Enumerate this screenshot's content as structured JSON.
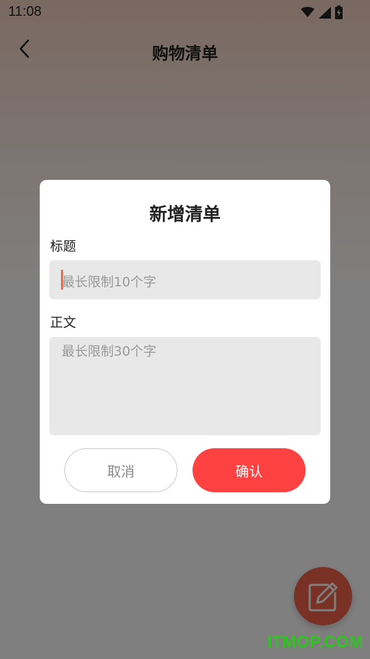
{
  "status_bar": {
    "time": "11:08",
    "icons": [
      "wifi-icon",
      "signal-icon",
      "battery-charging-icon"
    ]
  },
  "header": {
    "title": "购物清单",
    "back_icon": "chevron-left-icon"
  },
  "fab": {
    "icon": "edit-icon"
  },
  "watermark": "ITMOP.COM",
  "dialog": {
    "title": "新增清单",
    "title_label": "标题",
    "title_placeholder": "最长限制10个字",
    "body_label": "正文",
    "body_placeholder": "最长限制30个字",
    "cancel_label": "取消",
    "confirm_label": "确认"
  },
  "colors": {
    "accent": "#fe4141",
    "fab": "#f5624a",
    "input_bg": "#e8e8e8",
    "watermark": "#2fc31f"
  }
}
